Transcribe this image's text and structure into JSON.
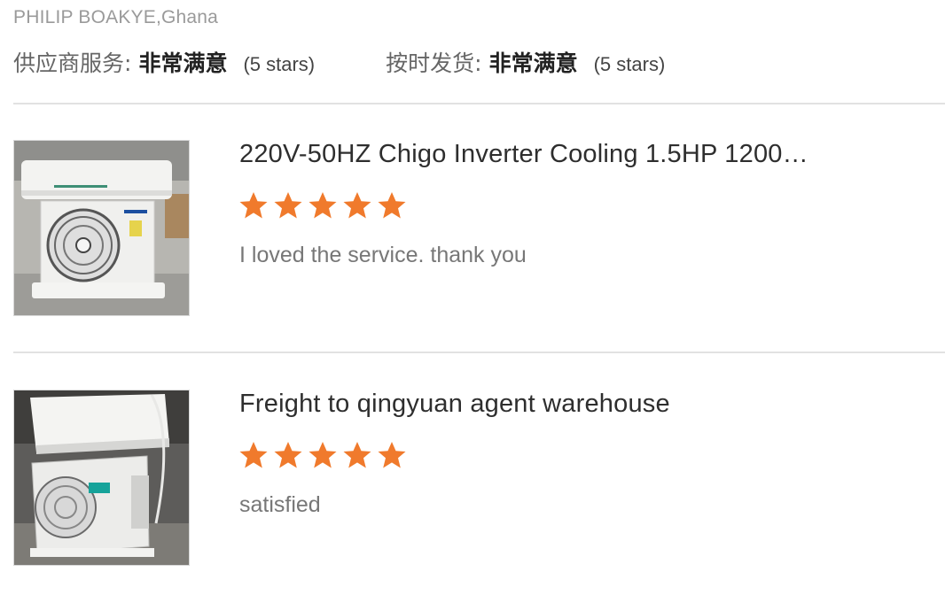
{
  "reviewer": "PHILIP BOAKYE,Ghana",
  "ratings": [
    {
      "label": "供应商服务:",
      "value": "非常满意",
      "stars_text": "(5 stars)"
    },
    {
      "label": "按时发货:",
      "value": "非常满意",
      "stars_text": "(5 stars)"
    }
  ],
  "star_color": "#f07a2c",
  "products": [
    {
      "title": "220V-50HZ Chigo Inverter Cooling 1.5HP 1200…",
      "rating": 5,
      "comment": "I loved the service. thank you",
      "image_icon": "air-conditioner-photo"
    },
    {
      "title": "Freight to qingyuan agent warehouse",
      "rating": 5,
      "comment": "satisfied",
      "image_icon": "air-conditioner-photo"
    }
  ]
}
